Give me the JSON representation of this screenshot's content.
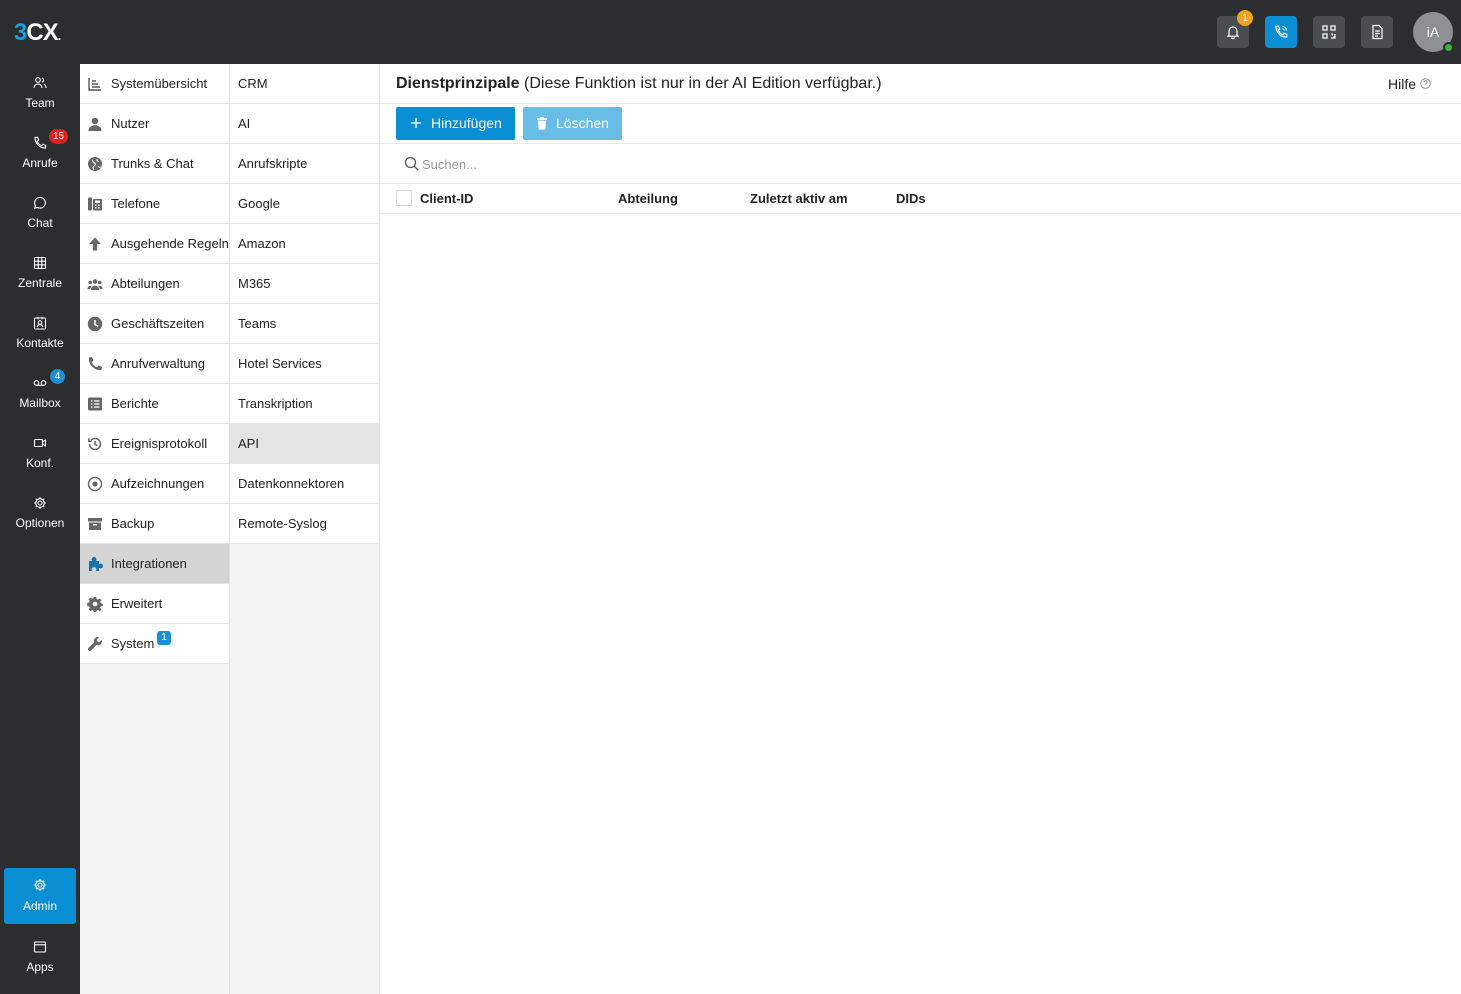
{
  "header": {
    "logo": {
      "prefix": "3",
      "main": "CX",
      "dot": "."
    },
    "notifications_count": "1",
    "avatar_initials": "iA"
  },
  "nav": {
    "items": [
      {
        "label": "Team",
        "icon": "users-icon"
      },
      {
        "label": "Anrufe",
        "icon": "phone-icon",
        "badge": "15"
      },
      {
        "label": "Chat",
        "icon": "chat-icon"
      },
      {
        "label": "Zentrale",
        "icon": "grid-icon"
      },
      {
        "label": "Kontakte",
        "icon": "contacts-icon"
      },
      {
        "label": "Mailbox",
        "icon": "voicemail-icon",
        "badge": "4"
      },
      {
        "label": "Konf.",
        "icon": "video-icon"
      },
      {
        "label": "Optionen",
        "icon": "gear-icon"
      }
    ],
    "admin": "Admin",
    "apps": "Apps"
  },
  "settings_menu": [
    {
      "label": "Systemübersicht"
    },
    {
      "label": "Nutzer"
    },
    {
      "label": "Trunks & Chat"
    },
    {
      "label": "Telefone"
    },
    {
      "label": "Ausgehende Regeln"
    },
    {
      "label": "Abteilungen"
    },
    {
      "label": "Geschäftszeiten"
    },
    {
      "label": "Anrufverwaltung"
    },
    {
      "label": "Berichte"
    },
    {
      "label": "Ereignisprotokoll"
    },
    {
      "label": "Aufzeichnungen"
    },
    {
      "label": "Backup"
    },
    {
      "label": "Integrationen",
      "active": true
    },
    {
      "label": "Erweitert"
    },
    {
      "label": "System",
      "badge": "1"
    }
  ],
  "integrations_menu": [
    {
      "label": "CRM"
    },
    {
      "label": "AI"
    },
    {
      "label": "Anrufskripte"
    },
    {
      "label": "Google"
    },
    {
      "label": "Amazon"
    },
    {
      "label": "M365"
    },
    {
      "label": "Teams"
    },
    {
      "label": "Hotel Services"
    },
    {
      "label": "Transkription"
    },
    {
      "label": "API",
      "active": true
    },
    {
      "label": "Datenkonnektoren"
    },
    {
      "label": "Remote-Syslog"
    }
  ],
  "main": {
    "title_bold": "Dienstprinzipale",
    "title_note": " (Diese Funktion ist nur in der AI Edition verfügbar.)",
    "help": "Hilfe",
    "add_button": "Hinzufügen",
    "delete_button": "Löschen",
    "search_placeholder": "Suchen...",
    "columns": [
      "Client-ID",
      "Abteilung",
      "Zuletzt aktiv am",
      "DIDs"
    ]
  },
  "colors": {
    "accent": "#0a8fd4",
    "sidebar_bg": "#2b2d2f",
    "badge_red": "#e02020",
    "badge_orange": "#f0a31c"
  }
}
